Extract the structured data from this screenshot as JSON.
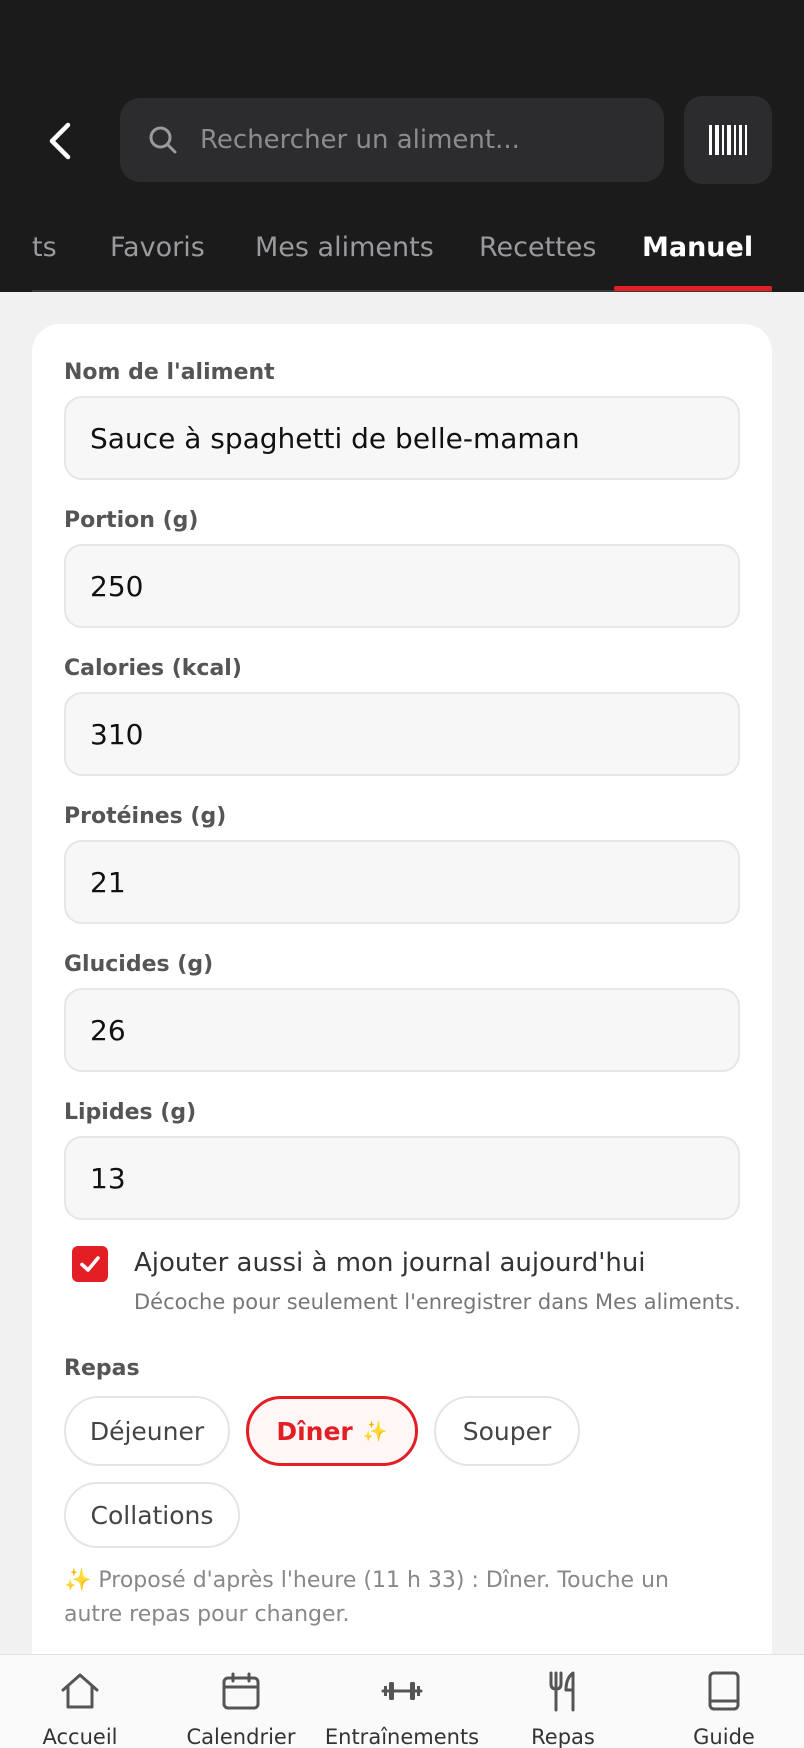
{
  "header": {
    "search_placeholder": "Rechercher un aliment...",
    "tabs": [
      {
        "label": "ts"
      },
      {
        "label": "Favoris"
      },
      {
        "label": "Mes aliments"
      },
      {
        "label": "Recettes"
      },
      {
        "label": "Manuel",
        "active": true
      }
    ]
  },
  "form": {
    "fields": [
      {
        "label": "Nom de l'aliment",
        "value": "Sauce à spaghetti de belle-maman"
      },
      {
        "label": "Portion (g)",
        "value": "250"
      },
      {
        "label": "Calories (kcal)",
        "value": "310"
      },
      {
        "label": "Protéines (g)",
        "value": "21"
      },
      {
        "label": "Glucides (g)",
        "value": "26"
      },
      {
        "label": "Lipides (g)",
        "value": "13"
      }
    ],
    "add_to_journal": {
      "checked": true,
      "label": "Ajouter aussi à mon journal aujourd'hui",
      "sublabel": "Décoche pour seulement l'enregistrer dans Mes aliments."
    },
    "meal_label": "Repas",
    "meals": [
      {
        "label": "Déjeuner"
      },
      {
        "label": "Dîner",
        "suffix": "✨",
        "selected": true
      },
      {
        "label": "Souper"
      },
      {
        "label": "Collations"
      }
    ],
    "hint": "✨ Proposé d'après l'heure (11 h 33) : Dîner. Touche un autre repas pour changer."
  },
  "bottom_nav": [
    {
      "label": "Accueil",
      "icon": "home-icon"
    },
    {
      "label": "Calendrier",
      "icon": "calendar-icon"
    },
    {
      "label": "Entraînements",
      "icon": "dumbbell-icon"
    },
    {
      "label": "Repas",
      "icon": "fork-knife-icon"
    },
    {
      "label": "Guide",
      "icon": "book-icon"
    }
  ],
  "colors": {
    "accent": "#e31e24",
    "header_bg": "#1b1b1c",
    "page_bg": "#f1f1f1"
  }
}
